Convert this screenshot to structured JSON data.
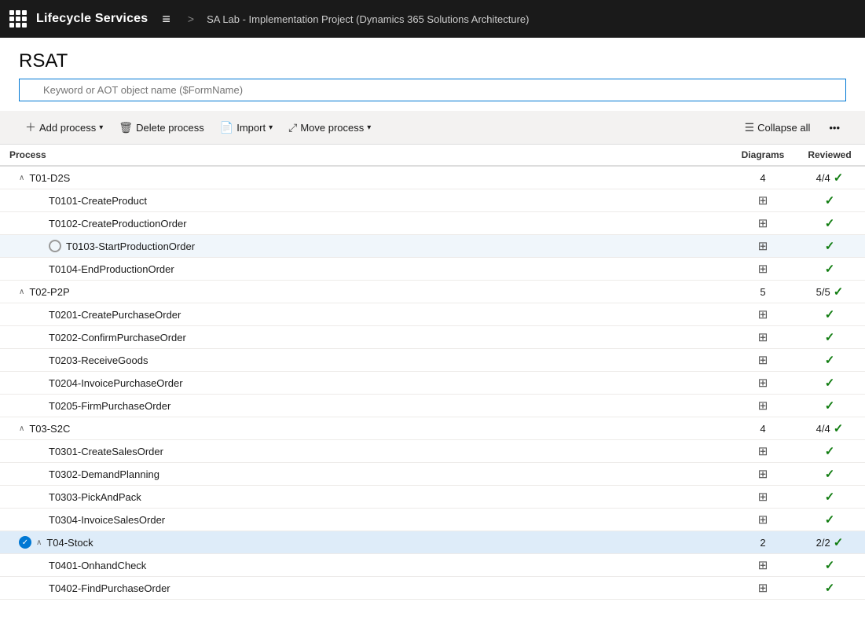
{
  "header": {
    "title": "Lifecycle Services",
    "menu_icon": "≡",
    "separator": ">",
    "breadcrumb": "SA Lab - Implementation Project (Dynamics 365 Solutions Architecture)"
  },
  "page_title": "RSAT",
  "search": {
    "placeholder": "Keyword or AOT object name ($FormName)"
  },
  "toolbar": {
    "add_process": "Add process",
    "delete_process": "Delete process",
    "import": "Import",
    "move_process": "Move process",
    "collapse_all": "Collapse all"
  },
  "table": {
    "columns": {
      "process": "Process",
      "diagrams": "Diagrams",
      "reviewed": "Reviewed"
    },
    "rows": [
      {
        "id": "g1",
        "type": "group",
        "name": "T01-D2S",
        "diagrams": "4",
        "reviewed": "4/4",
        "indent": 0,
        "selected": false,
        "checked": false
      },
      {
        "id": "r1",
        "type": "row",
        "name": "T0101-CreateProduct",
        "diagrams": "",
        "reviewed": "✓",
        "indent": 1,
        "selected": false,
        "checked": false
      },
      {
        "id": "r2",
        "type": "row",
        "name": "T0102-CreateProductionOrder",
        "diagrams": "",
        "reviewed": "✓",
        "indent": 1,
        "selected": false,
        "checked": false
      },
      {
        "id": "r3",
        "type": "row",
        "name": "T0103-StartProductionOrder",
        "diagrams": "",
        "reviewed": "✓",
        "indent": 1,
        "selected": true,
        "radio": true,
        "checked": false
      },
      {
        "id": "r4",
        "type": "row",
        "name": "T0104-EndProductionOrder",
        "diagrams": "",
        "reviewed": "✓",
        "indent": 1,
        "selected": false,
        "checked": false
      },
      {
        "id": "g2",
        "type": "group",
        "name": "T02-P2P",
        "diagrams": "5",
        "reviewed": "5/5",
        "indent": 0,
        "selected": false,
        "checked": false
      },
      {
        "id": "r5",
        "type": "row",
        "name": "T0201-CreatePurchaseOrder",
        "diagrams": "",
        "reviewed": "✓",
        "indent": 1,
        "selected": false,
        "checked": false
      },
      {
        "id": "r6",
        "type": "row",
        "name": "T0202-ConfirmPurchaseOrder",
        "diagrams": "",
        "reviewed": "✓",
        "indent": 1,
        "selected": false,
        "checked": false
      },
      {
        "id": "r7",
        "type": "row",
        "name": "T0203-ReceiveGoods",
        "diagrams": "",
        "reviewed": "✓",
        "indent": 1,
        "selected": false,
        "checked": false
      },
      {
        "id": "r8",
        "type": "row",
        "name": "T0204-InvoicePurchaseOrder",
        "diagrams": "",
        "reviewed": "✓",
        "indent": 1,
        "selected": false,
        "checked": false
      },
      {
        "id": "r9",
        "type": "row",
        "name": "T0205-FirmPurchaseOrder",
        "diagrams": "",
        "reviewed": "✓",
        "indent": 1,
        "selected": false,
        "checked": false
      },
      {
        "id": "g3",
        "type": "group",
        "name": "T03-S2C",
        "diagrams": "4",
        "reviewed": "4/4",
        "indent": 0,
        "selected": false,
        "checked": false
      },
      {
        "id": "r10",
        "type": "row",
        "name": "T0301-CreateSalesOrder",
        "diagrams": "",
        "reviewed": "✓",
        "indent": 1,
        "selected": false,
        "checked": false
      },
      {
        "id": "r11",
        "type": "row",
        "name": "T0302-DemandPlanning",
        "diagrams": "",
        "reviewed": "✓",
        "indent": 1,
        "selected": false,
        "checked": false
      },
      {
        "id": "r12",
        "type": "row",
        "name": "T0303-PickAndPack",
        "diagrams": "",
        "reviewed": "✓",
        "indent": 1,
        "selected": false,
        "checked": false
      },
      {
        "id": "r13",
        "type": "row",
        "name": "T0304-InvoiceSalesOrder",
        "diagrams": "",
        "reviewed": "✓",
        "indent": 1,
        "selected": false,
        "checked": false
      },
      {
        "id": "g4",
        "type": "group",
        "name": "T04-Stock",
        "diagrams": "2",
        "reviewed": "2/2",
        "indent": 0,
        "selected": true,
        "checked": true
      },
      {
        "id": "r14",
        "type": "row",
        "name": "T0401-OnhandCheck",
        "diagrams": "",
        "reviewed": "✓",
        "indent": 1,
        "selected": false,
        "checked": false
      },
      {
        "id": "r15",
        "type": "row",
        "name": "T0402-FindPurchaseOrder",
        "diagrams": "",
        "reviewed": "✓",
        "indent": 1,
        "selected": false,
        "checked": false
      }
    ]
  }
}
